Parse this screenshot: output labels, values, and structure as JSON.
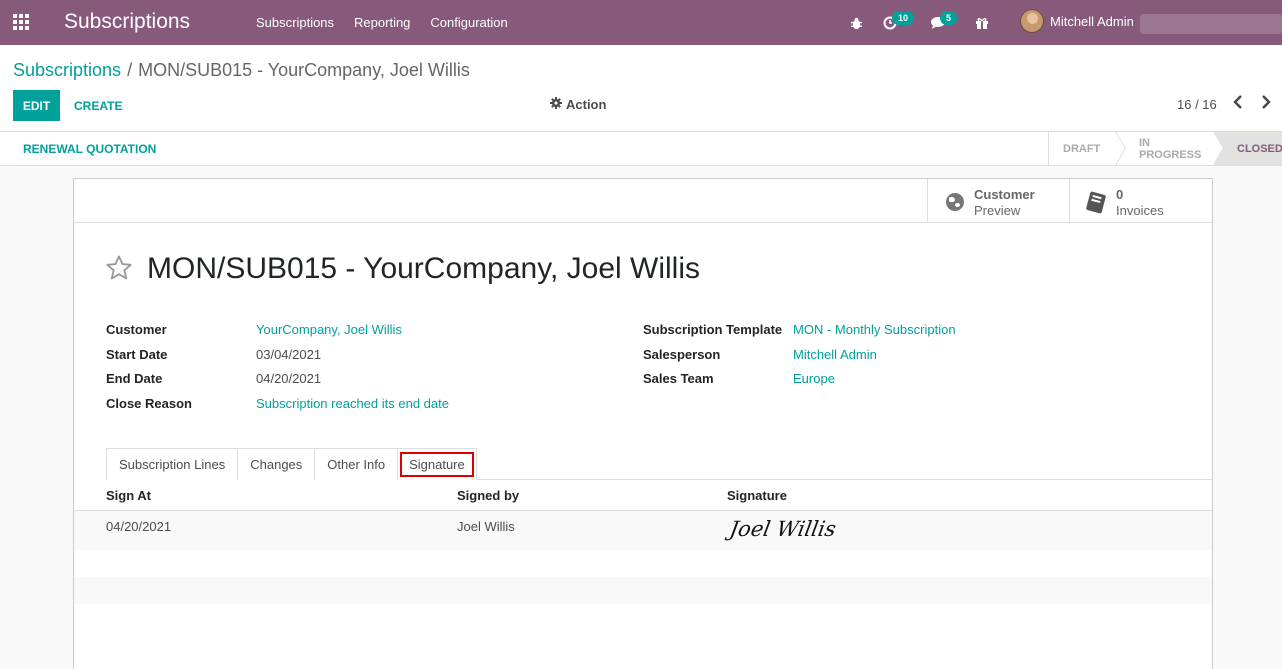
{
  "navbar": {
    "app_title": "Subscriptions",
    "menu": [
      "Subscriptions",
      "Reporting",
      "Configuration"
    ],
    "activity_count": "10",
    "message_count": "5",
    "user_name": "Mitchell Admin",
    "icons": [
      "apps-icon",
      "bug-icon",
      "clock-icon",
      "chat-icon",
      "gift-icon"
    ],
    "brand_color": "#875a7b"
  },
  "control_panel": {
    "breadcrumb_parent": "Subscriptions",
    "breadcrumb_separator": "/",
    "breadcrumb_current": "MON/SUB015 - YourCompany, Joel Willis",
    "edit_label": "EDIT",
    "create_label": "CREATE",
    "action_label": "Action",
    "pager": "16 / 16"
  },
  "statusbar": {
    "renewal_label": "RENEWAL QUOTATION",
    "stages": [
      "DRAFT",
      "IN PROGRESS",
      "CLOSED"
    ],
    "current_stage": "CLOSED"
  },
  "smart_buttons": {
    "preview_line1": "Customer",
    "preview_line2": "Preview",
    "invoices_count": "0",
    "invoices_label": "Invoices"
  },
  "record": {
    "title": "MON/SUB015 - YourCompany, Joel Willis"
  },
  "fields": {
    "customer_label": "Customer",
    "customer_value": "YourCompany, Joel Willis",
    "start_date_label": "Start Date",
    "start_date_value": "03/04/2021",
    "end_date_label": "End Date",
    "end_date_value": "04/20/2021",
    "close_reason_label": "Close Reason",
    "close_reason_value": "Subscription reached its end date",
    "template_label": "Subscription Template",
    "template_value": "MON - Monthly Subscription",
    "salesperson_label": "Salesperson",
    "salesperson_value": "Mitchell Admin",
    "sales_team_label": "Sales Team",
    "sales_team_value": "Europe"
  },
  "notebook": {
    "tabs": [
      "Subscription Lines",
      "Changes",
      "Other Info",
      "Signature"
    ],
    "active_tab": "Signature"
  },
  "signature_table": {
    "headers": [
      "Sign At",
      "Signed by",
      "Signature"
    ],
    "rows": [
      {
        "sign_at": "04/20/2021",
        "signed_by": "Joel Willis",
        "signature": "Joel Willis"
      }
    ]
  },
  "accent_color": "#00a09d"
}
